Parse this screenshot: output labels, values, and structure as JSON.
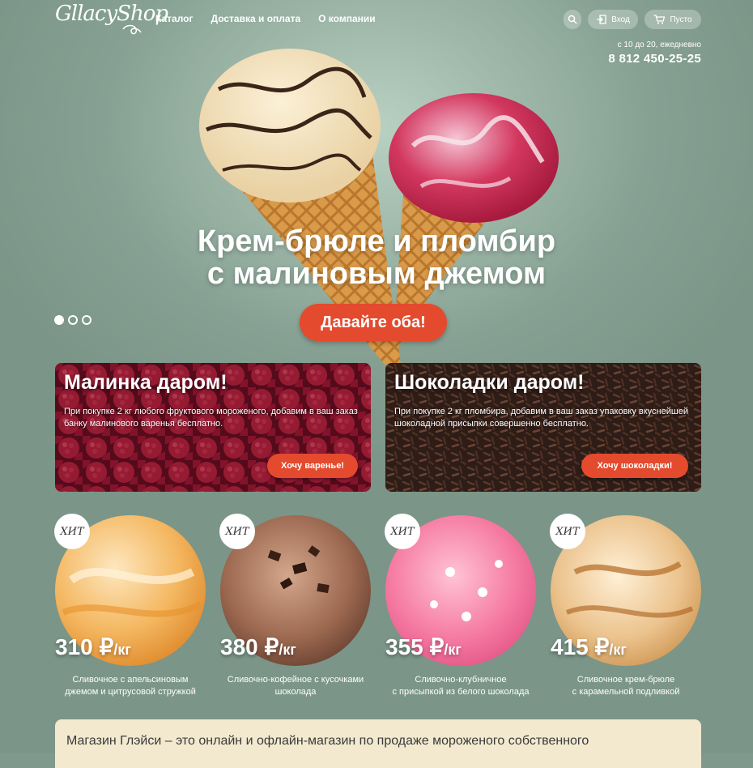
{
  "header": {
    "logo": "GllacyShop",
    "nav": [
      "Каталог",
      "Доставка и оплата",
      "О компании"
    ],
    "login_label": "Вход",
    "cart_label": "Пусто",
    "hours": "с 10 до 20, ежедневно",
    "phone": "8 812 450-25-25"
  },
  "hero": {
    "title_line1": "Крем-брюле и пломбир",
    "title_line2": "с малиновым джемом",
    "cta_label": "Давайте оба!",
    "slides_total": 3,
    "active_slide": 1
  },
  "promos": [
    {
      "title": "Малинка даром!",
      "text": "При покупке 2 кг любого фруктового мороженого, добавим в ваш заказ банку малинового варенья бесплатно.",
      "button": "Хочу варенье!"
    },
    {
      "title": "Шоколадки даром!",
      "text": "При покупке 2 кг пломбира, добавим в ваш заказ упаковку вкуснейшей шоколадной присыпки совершенно бесплатно.",
      "button": "Хочу шоколадки!"
    }
  ],
  "products": [
    {
      "badge": "ХИТ",
      "price": "310 ₽",
      "unit": "/кг",
      "name_line1": "Сливочное с апельсиновым",
      "name_line2": "джемом и цитрусовой стружкой",
      "color": "#f2b060"
    },
    {
      "badge": "ХИТ",
      "price": "380 ₽",
      "unit": "/кг",
      "name_line1": "Сливочно-кофейное с кусочками",
      "name_line2": "шоколада",
      "color": "#a8735a"
    },
    {
      "badge": "ХИТ",
      "price": "355 ₽",
      "unit": "/кг",
      "name_line1": "Сливочно-клубничное",
      "name_line2": "с присыпкой из белого шоколада",
      "color": "#f27fa4"
    },
    {
      "badge": "ХИТ",
      "price": "415 ₽",
      "unit": "/кг",
      "name_line1": "Сливочное крем-брюле",
      "name_line2": "с карамельной подливкой",
      "color": "#e2b880"
    }
  ],
  "about": {
    "text": "Магазин Глэйси – это онлайн и офлайн-магазин по продаже мороженого собственного"
  }
}
